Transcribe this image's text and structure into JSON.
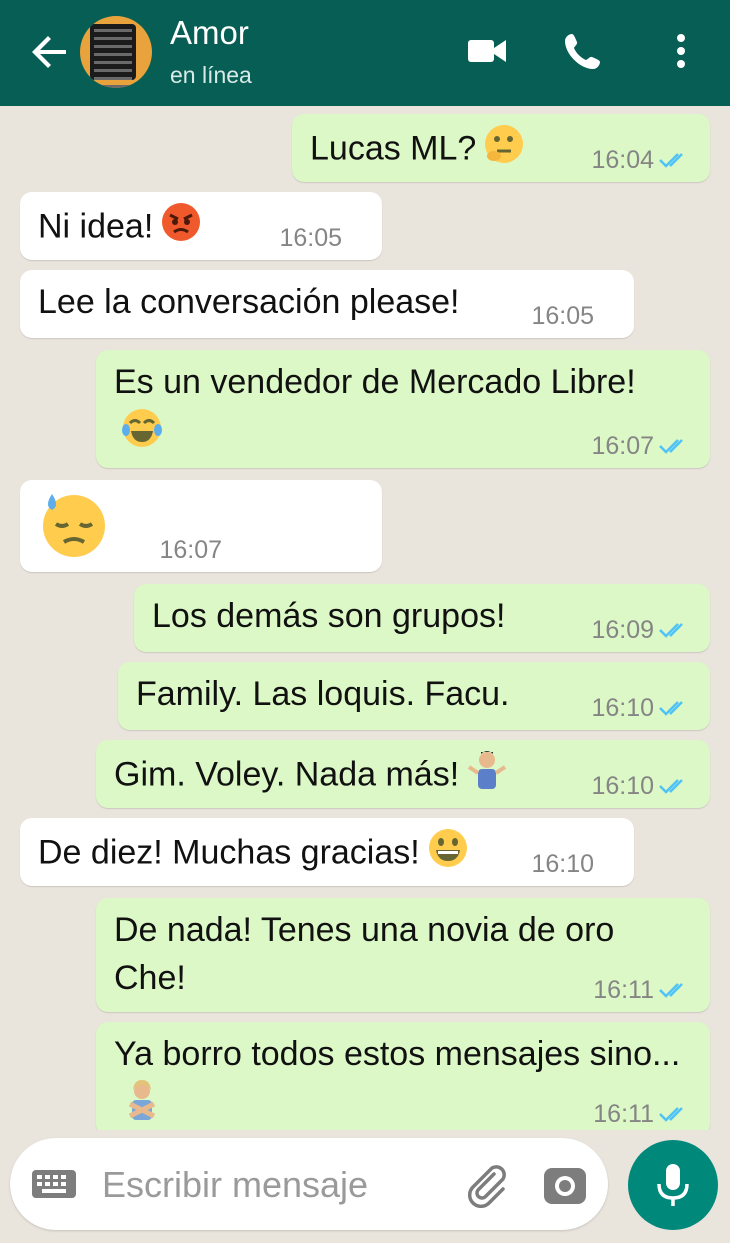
{
  "header": {
    "contact_name": "Amor",
    "status": "en línea",
    "icons": [
      "back-arrow-icon",
      "video-call-icon",
      "phone-icon",
      "more-vert-icon"
    ]
  },
  "messages": [
    {
      "direction": "out",
      "text": "Lucas ML?",
      "emoji": "thinking-face",
      "time": "16:04",
      "read": true
    },
    {
      "direction": "in",
      "text": "Ni idea!",
      "emoji": "angry-face",
      "time": "16:05"
    },
    {
      "direction": "in",
      "text": "Lee la conversación please!",
      "time": "16:05"
    },
    {
      "direction": "out",
      "text": "Es un vendedor de Mercado Libre!",
      "emoji": "tears-of-joy-face",
      "time": "16:07",
      "read": true
    },
    {
      "direction": "in",
      "text": "",
      "emoji": "downcast-sweat-face",
      "time": "16:07"
    },
    {
      "direction": "out",
      "text": "Los demás son grupos!",
      "time": "16:09",
      "read": true
    },
    {
      "direction": "out",
      "text": "Family. Las loquis. Facu.",
      "time": "16:10",
      "read": true
    },
    {
      "direction": "out",
      "text": "Gim. Voley. Nada más!",
      "emoji": "shrugging-man",
      "time": "16:10",
      "read": true
    },
    {
      "direction": "in",
      "text": "De diez! Muchas gracias!",
      "emoji": "grinning-face",
      "time": "16:10"
    },
    {
      "direction": "out",
      "text": "De nada! Tenes una novia de oro Che!",
      "time": "16:11",
      "read": true
    },
    {
      "direction": "out",
      "text": "Ya borro todos estos mensajes sino...",
      "emoji": "gesturing-no-woman",
      "time": "16:11",
      "read": true
    }
  ],
  "input": {
    "placeholder": "Escribir mensaje",
    "icons": [
      "keyboard-icon",
      "attach-clip-icon",
      "camera-icon",
      "mic-icon"
    ]
  },
  "colors": {
    "header": "#075e54",
    "outgoing_bubble": "#dcf8c6",
    "incoming_bubble": "#ffffff",
    "read_ticks": "#4fc3f7",
    "mic_button": "#00897b",
    "chat_background": "#e9e4dc"
  }
}
